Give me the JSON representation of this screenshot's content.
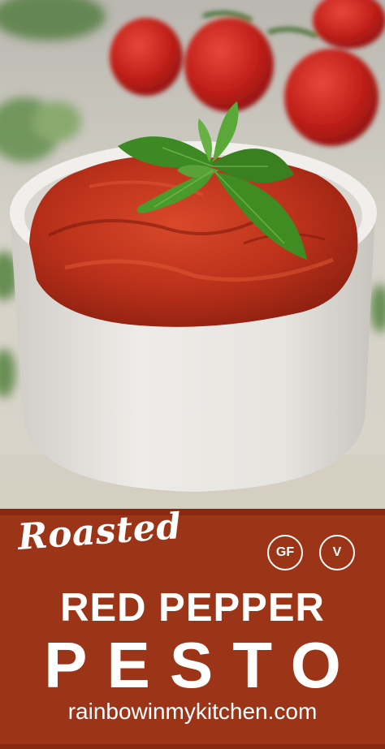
{
  "photo": {
    "alt_subject": "bowl-of-red-pepper-pesto-with-basil",
    "colors": {
      "pesto": "#c4361c",
      "bowl": "#e9e7e2",
      "basil": "#3a7a22",
      "tomato": "#c8201a",
      "banner": "#9c3418"
    }
  },
  "banner": {
    "script_word": "Roasted",
    "title_line1": "RED PEPPER",
    "title_line2": "PESTO",
    "website": "rainbowinmykitchen.com",
    "badges": [
      "GF",
      "V"
    ]
  }
}
